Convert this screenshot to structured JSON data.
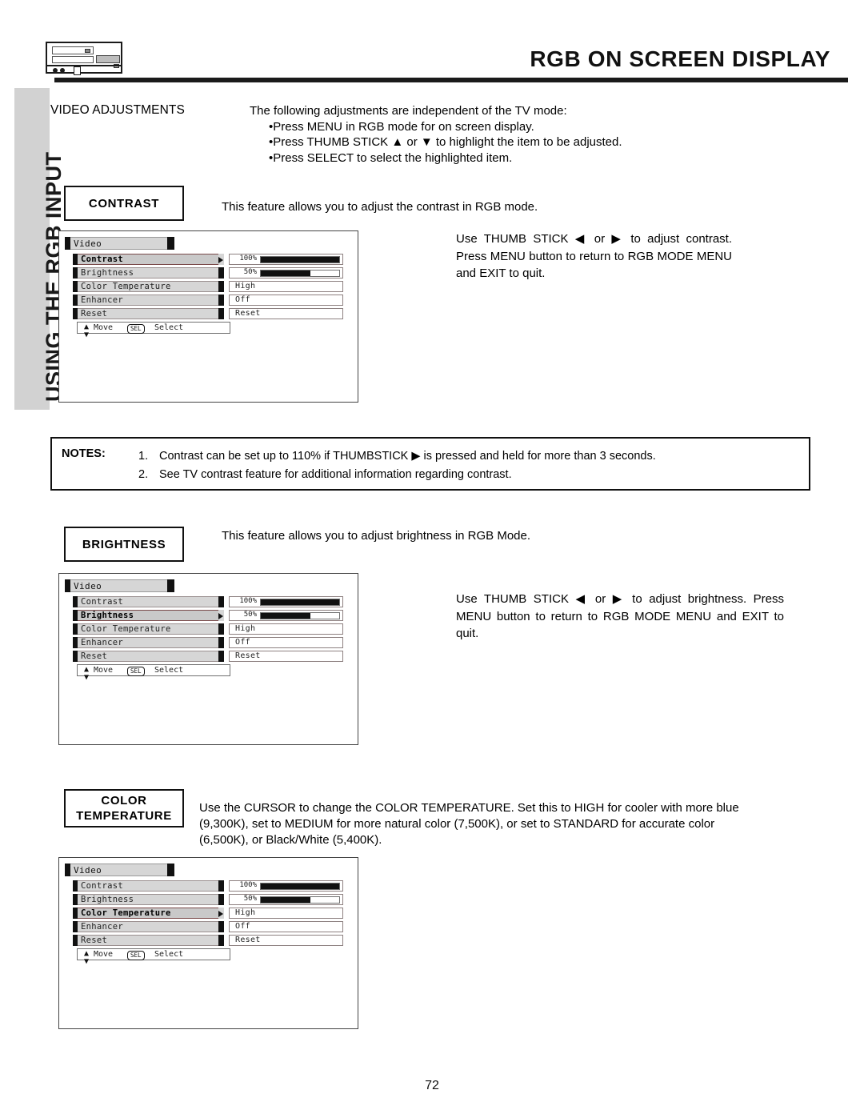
{
  "header": {
    "title": "RGB ON SCREEN DISPLAY",
    "device_icon": "av-component-icon"
  },
  "sidebar": {
    "label": "USING THE RGB INPUT"
  },
  "page": {
    "number": "72"
  },
  "intro": {
    "label": "VIDEO ADJUSTMENTS",
    "lead": "The following adjustments are independent of the TV mode:",
    "bullets": [
      "Press MENU in RGB mode for on screen display.",
      "Press THUMB STICK ▲ or ▼ to highlight the item to be adjusted.",
      "Press SELECT to select the highlighted item."
    ]
  },
  "sections": {
    "contrast": {
      "label": "CONTRAST",
      "description": "This feature allows you to adjust the contrast in RGB mode.",
      "instructions": "Use THUMB STICK ◀ or ▶ to adjust contrast. Press MENU button to return to RGB MODE MENU and EXIT to quit."
    },
    "brightness": {
      "label": "BRIGHTNESS",
      "description": "This feature allows you to adjust brightness in RGB Mode.",
      "instructions": "Use THUMB STICK ◀ or ▶ to adjust brightness. Press MENU button to return to RGB MODE MENU and EXIT to quit."
    },
    "color_temperature": {
      "label_line1": "COLOR",
      "label_line2": "TEMPERATURE",
      "description": "Use the CURSOR to change the COLOR TEMPERATURE.  Set this to HIGH for cooler with more blue (9,300K), set to MEDIUM for more natural color (7,500K), or set to STANDARD for accurate color (6,500K), or Black/White (5,400K)."
    }
  },
  "notes": {
    "label": "NOTES:",
    "items": [
      {
        "num": "1.",
        "text": "Contrast can be set up to 110% if THUMBSTICK ▶ is pressed and held for more than 3 seconds."
      },
      {
        "num": "2.",
        "text": "See TV contrast feature for additional information regarding contrast."
      }
    ]
  },
  "osd": {
    "title": "Video",
    "footer": {
      "move_label": "Move",
      "select_key": "SEL",
      "select_label": "Select",
      "updown_icon": "up-down-arrow-icon"
    },
    "rows": [
      {
        "label": "Contrast",
        "value": "100%",
        "type": "bar",
        "fill": 100
      },
      {
        "label": "Brightness",
        "value": "50%",
        "type": "bar",
        "fill": 63
      },
      {
        "label": "Color Temperature",
        "value": "High",
        "type": "text",
        "fill": 0
      },
      {
        "label": "Enhancer",
        "value": "Off",
        "type": "text",
        "fill": 0
      },
      {
        "label": "Reset",
        "value": "Reset",
        "type": "text",
        "fill": 0
      }
    ],
    "menus": [
      {
        "id": "osd-1",
        "selected_index": 0,
        "selected_label": "Contrast"
      },
      {
        "id": "osd-2",
        "selected_index": 1,
        "selected_label": "Brightness"
      },
      {
        "id": "osd-3",
        "selected_index": 2,
        "selected_label": "Color Temperature"
      }
    ]
  }
}
